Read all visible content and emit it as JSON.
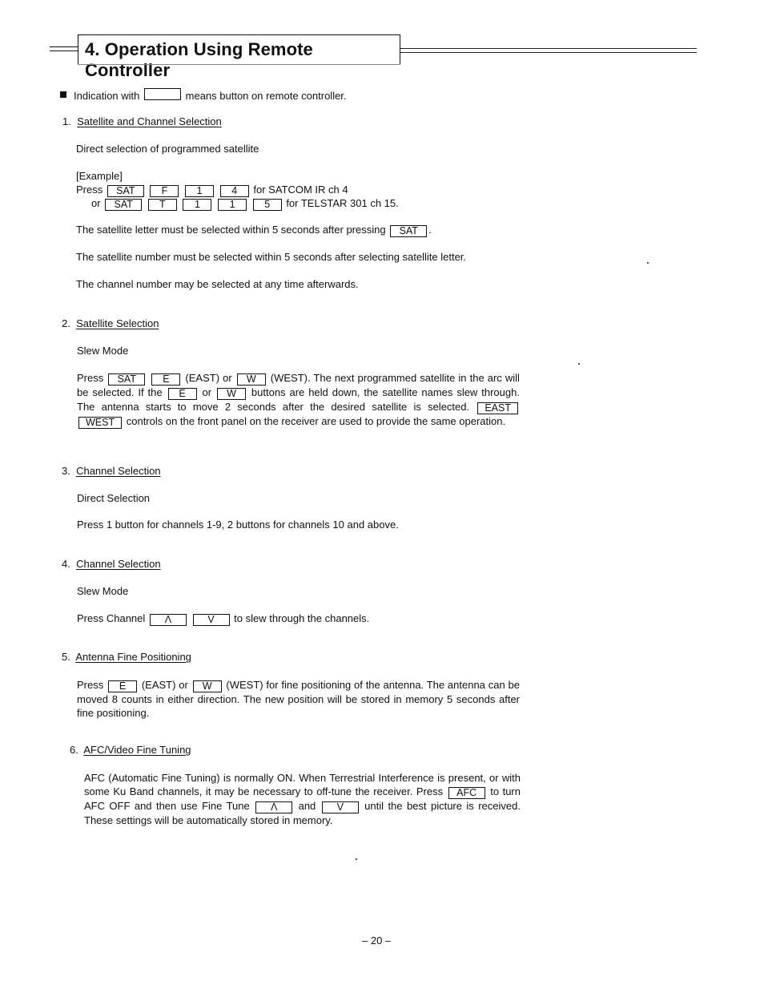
{
  "header": {
    "title": "4.  Operation Using Remote Controller"
  },
  "intro": {
    "prefix": "Indication with",
    "suffix": "means button on remote controller."
  },
  "sections": [
    {
      "number": "1.",
      "title": "Satellite and Channel Selection",
      "subtitle": "Direct selection of programmed satellite",
      "example_label": "[Example]",
      "example_rows": [
        {
          "lead": "Press",
          "keys": [
            "SAT",
            "F",
            "1",
            "4"
          ],
          "trail": "for SATCOM IR ch 4"
        },
        {
          "lead": "or",
          "keys": [
            "SAT",
            "T",
            "1",
            "1",
            "5"
          ],
          "trail": "for TELSTAR 301 ch 15."
        }
      ],
      "note1_text": "The satellite letter must be selected within 5 seconds after pressing",
      "note1_key": "SAT",
      "note2": "The satellite number must be selected within 5 seconds after selecting satellite letter.",
      "note3": "The channel number may be selected at any time afterwards."
    },
    {
      "number": "2.",
      "title": "Satellite Selection",
      "subtitle": "Slew Mode",
      "p_press": "Press",
      "keys": {
        "sat": "SAT",
        "e": "E",
        "w": "W",
        "east": "EAST",
        "west": "WEST"
      },
      "t_east": "(EAST) or",
      "t_west": "(WEST). The next programmed satellite in the",
      "t_arc": "arc will be selected. If the",
      "t_or": "or",
      "t_held": "buttons are held down, the satellite names",
      "t_slew": "slew through. The antenna starts to move 2 seconds after the desired satellite is selected.",
      "t_controls": "controls on the front panel on the receiver are used to provide",
      "t_same": "the same operation."
    },
    {
      "number": "3.",
      "title": "Channel Selection",
      "subtitle": "Direct Selection",
      "text": "Press 1 button for channels 1-9, 2 buttons for channels 10 and above."
    },
    {
      "number": "4.",
      "title": "Channel Selection",
      "subtitle": "Slew Mode",
      "lead": "Press Channel",
      "keys": [
        "Λ",
        "V"
      ],
      "trail": "to slew through the channels."
    },
    {
      "number": "5.",
      "title": "Antenna Fine Positioning",
      "lead": "Press",
      "key_e": "E",
      "t_east": "(EAST) or",
      "key_w": "W",
      "t_rest": "(WEST) for fine positioning of the antenna. The antenna",
      "line2": "can be moved 8 counts in either direction. The new position will be stored in memory",
      "line3": "5 seconds after fine positioning."
    },
    {
      "number": "6.",
      "title": "AFC/Video Fine Tuning",
      "line1": "AFC (Automatic Fine Tuning) is normally ON. When Terrestrial Interference is present,",
      "line2": "or with some Ku Band channels, it may be necessary to off-tune the receiver. Press",
      "key_afc": "AFC",
      "t_turn": "to turn AFC OFF and then use Fine Tune",
      "key_up": "Λ",
      "t_and": "and",
      "key_down": "V",
      "t_until": "until the best",
      "line4": "picture is received. These settings will be automatically stored in memory."
    }
  ],
  "footer": {
    "page_number": "– 20 –"
  }
}
